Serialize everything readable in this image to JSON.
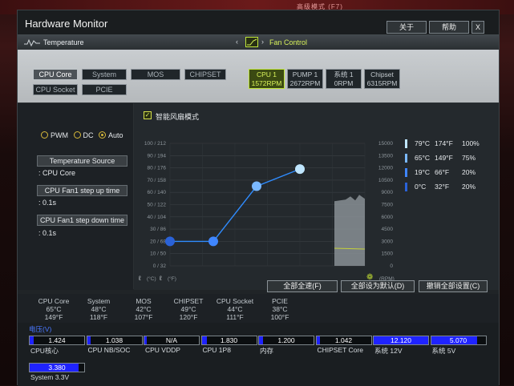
{
  "background": {
    "menu_text": "高级模式 (F7)"
  },
  "window": {
    "title": "Hardware Monitor",
    "buttons": [
      "关于",
      "帮助",
      "X"
    ]
  },
  "tabs": {
    "temperature": "Temperature",
    "fan_control": "Fan Control"
  },
  "sources": {
    "row1": [
      "CPU Core",
      "System",
      "MOS",
      "CHIPSET"
    ],
    "row2": [
      "CPU Socket",
      "PCIE"
    ],
    "selected": "CPU Core"
  },
  "fans": [
    {
      "name": "CPU 1",
      "rpm": "1572RPM",
      "selected": true
    },
    {
      "name": "PUMP 1",
      "rpm": "2672RPM",
      "selected": false
    },
    {
      "name": "系统 1",
      "rpm": "0RPM",
      "selected": false
    },
    {
      "name": "Chipset",
      "rpm": "6315RPM",
      "selected": false
    }
  ],
  "mode": {
    "options": [
      "PWM",
      "DC",
      "Auto"
    ],
    "selected": "Auto"
  },
  "left_controls": [
    {
      "button": "Temperature Source",
      "value": ": CPU Core"
    },
    {
      "button": "CPU Fan1 step up time",
      "value": ": 0.1s"
    },
    {
      "button": "CPU Fan1 step down time",
      "value": ": 0.1s"
    }
  ],
  "smart_fan": {
    "label": "智能风扇模式",
    "checked": true
  },
  "chart_data": {
    "type": "line",
    "title": "",
    "y_left_ticks": [
      "100 / 212",
      "90 / 194",
      "80 / 176",
      "70 / 158",
      "60 / 140",
      "50 / 122",
      "40 / 104",
      "30 / 86",
      "20 / 68",
      "10 / 50",
      "0 / 32"
    ],
    "y_right_ticks": [
      "15000",
      "13500",
      "12000",
      "10500",
      "9000",
      "7500",
      "6000",
      "4500",
      "3000",
      "1500",
      "0"
    ],
    "x_axis_left_label": "(°C)",
    "x_axis_left_label2": "(°F)",
    "x_axis_right_label": "(RPM)",
    "ylim_temp": [
      0,
      100
    ],
    "ylim_rpm": [
      0,
      15000
    ],
    "curve_points": [
      {
        "x": 0,
        "y": 20
      },
      {
        "x": 1,
        "y": 20
      },
      {
        "x": 2,
        "y": 65
      },
      {
        "x": 3,
        "y": 79
      }
    ],
    "x_range": [
      0,
      4.5
    ],
    "history_rpm_top": 8500
  },
  "curve_table": [
    {
      "c": "79°C",
      "f": "174°F",
      "pct": "100%",
      "color": "#bfe6ff"
    },
    {
      "c": "65°C",
      "f": "149°F",
      "pct": "75%",
      "color": "#7ab8ff"
    },
    {
      "c": "19°C",
      "f": "66°F",
      "pct": "20%",
      "color": "#3f86ff"
    },
    {
      "c": "0°C",
      "f": "32°F",
      "pct": "20%",
      "color": "#2a62d8"
    }
  ],
  "actions": [
    "全部全速(F)",
    "全部设为默认(D)",
    "撤销全部设置(C)"
  ],
  "temps": [
    {
      "name": "CPU Core",
      "c": "65°C",
      "f": "149°F"
    },
    {
      "name": "System",
      "c": "48°C",
      "f": "118°F"
    },
    {
      "name": "MOS",
      "c": "42°C",
      "f": "107°F"
    },
    {
      "name": "CHIPSET",
      "c": "49°C",
      "f": "120°F"
    },
    {
      "name": "CPU Socket",
      "c": "44°C",
      "f": "111°F"
    },
    {
      "name": "PCIE",
      "c": "38°C",
      "f": "100°F"
    }
  ],
  "voltage": {
    "title": "电压(V)",
    "items": [
      {
        "name": "CPU核心",
        "value": "1.424",
        "level": 0.08
      },
      {
        "name": "CPU NB/SOC",
        "value": "1.038",
        "level": 0.06
      },
      {
        "name": "CPU VDDP",
        "value": "N/A",
        "level": 0.0
      },
      {
        "name": "CPU 1P8",
        "value": "1.830",
        "level": 0.1
      },
      {
        "name": "内存",
        "value": "1.200",
        "level": 0.07
      },
      {
        "name": "CHIPSET Core",
        "value": "1.042",
        "level": 0.06
      },
      {
        "name": "系统 12V",
        "value": "12.120",
        "level": 1.0
      },
      {
        "name": "系统 5V",
        "value": "5.070",
        "level": 0.85
      },
      {
        "name": "System 3.3V",
        "value": "3.380",
        "level": 0.9
      }
    ]
  }
}
